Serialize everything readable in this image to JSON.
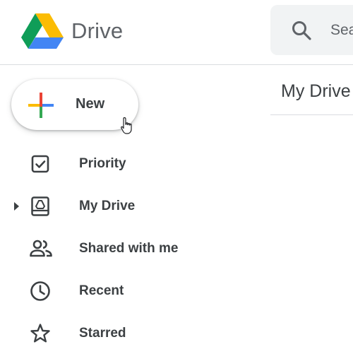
{
  "header": {
    "app_name": "Drive",
    "logo_icon": "google-drive-logo",
    "search": {
      "placeholder": "Search in Drive",
      "visible_text": "Sea",
      "icon": "search-icon"
    }
  },
  "sidebar": {
    "new_button": {
      "label": "New",
      "icon": "plus-icon"
    },
    "items": [
      {
        "label": "Priority",
        "icon": "priority-checkbox-icon"
      },
      {
        "label": "My Drive",
        "icon": "my-drive-icon",
        "expandable": true
      },
      {
        "label": "Shared with me",
        "icon": "people-icon"
      },
      {
        "label": "Recent",
        "icon": "clock-icon"
      },
      {
        "label": "Starred",
        "icon": "star-icon"
      }
    ]
  },
  "main": {
    "title": "My Drive"
  },
  "colors": {
    "google_blue": "#4285f4",
    "google_red": "#ea4335",
    "google_yellow": "#fbbc04",
    "google_green": "#34a853",
    "search_bg": "#f1f3f4",
    "text": "#3c4043",
    "icon_gray": "#5f6368"
  }
}
